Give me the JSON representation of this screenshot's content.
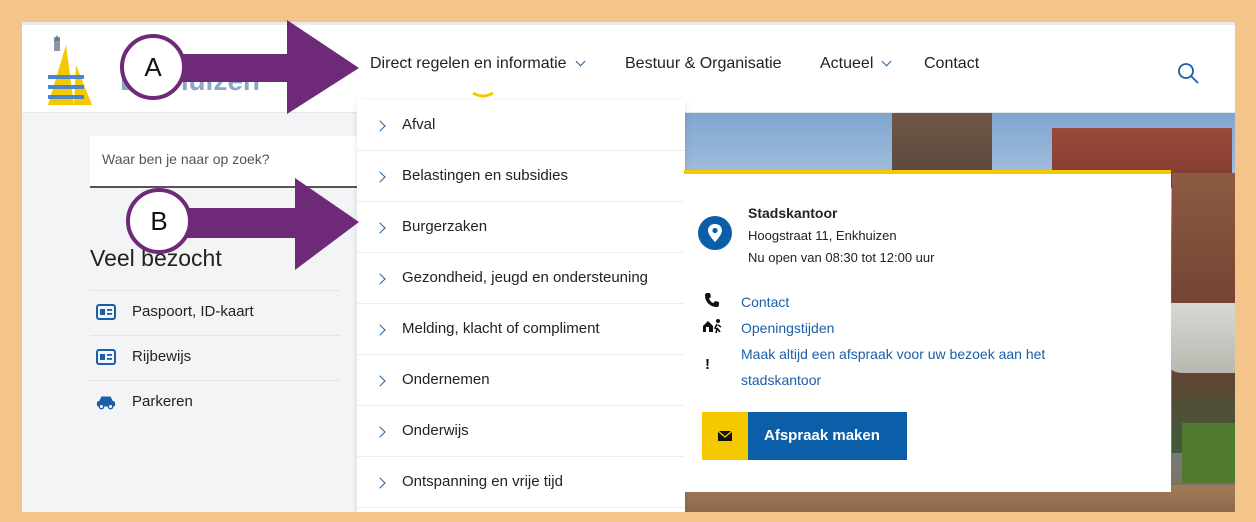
{
  "header": {
    "logo_text": "Enkhuizen",
    "nav": [
      {
        "label": "Direct regelen en informatie",
        "has_dropdown": true
      },
      {
        "label": "Bestuur & Organisatie",
        "has_dropdown": false
      },
      {
        "label": "Actueel",
        "has_dropdown": true
      },
      {
        "label": "Contact",
        "has_dropdown": false
      }
    ]
  },
  "search": {
    "placeholder": "Waar ben je naar op zoek?"
  },
  "popular": {
    "title": "Veel bezocht",
    "items": [
      {
        "label": "Paspoort, ID-kaart",
        "icon": "id-card-icon"
      },
      {
        "label": "Rijbewijs",
        "icon": "id-card-icon"
      },
      {
        "label": "Parkeren",
        "icon": "car-icon"
      }
    ]
  },
  "dropdown": {
    "items": [
      "Afval",
      "Belastingen en subsidies",
      "Burgerzaken",
      "Gezondheid, jeugd en ondersteuning",
      "Melding, klacht of compliment",
      "Ondernemen",
      "Onderwijs",
      "Ontspanning en vrije tijd"
    ]
  },
  "office": {
    "title": "Stadskantoor",
    "address": "Hoogstraat 11, Enkhuizen",
    "hours": "Nu open van 08:30 tot 12:00 uur",
    "links": {
      "contact": "Contact",
      "opening": "Openingstijden",
      "appointment_line1": "Maak altijd een afspraak voor uw bezoek aan het",
      "appointment_line2": "stadskantoor"
    },
    "button": "Afspraak maken"
  },
  "annotations": {
    "a": "A",
    "b": "B"
  },
  "colors": {
    "brand_blue": "#0b5ea8",
    "accent_yellow": "#f5c800",
    "callout_purple": "#6e2a78",
    "frame_orange": "#f4c58b"
  }
}
